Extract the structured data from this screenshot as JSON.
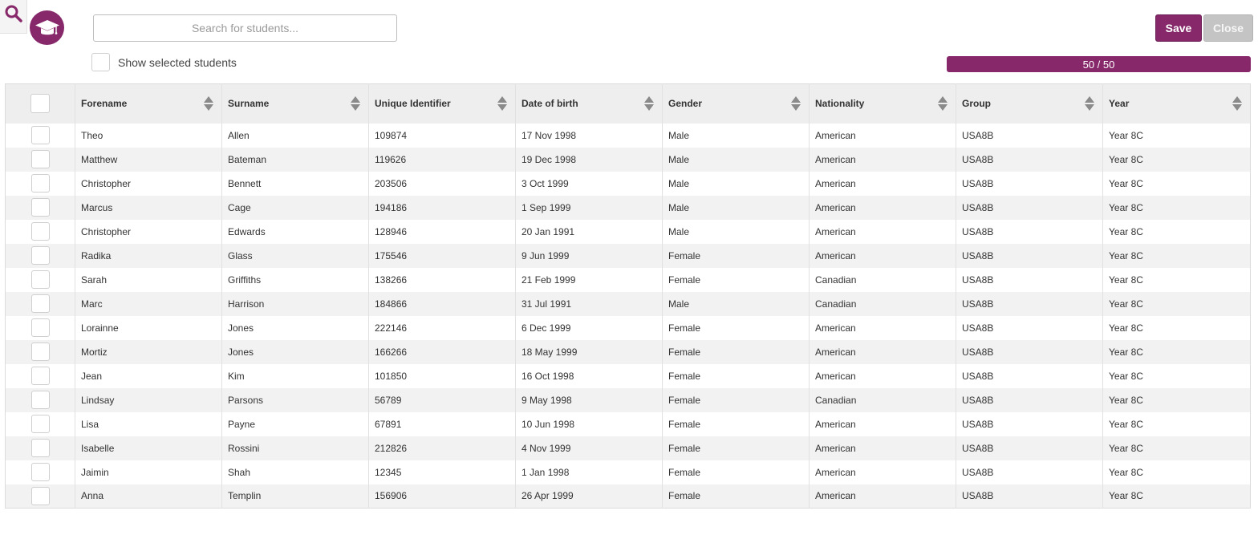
{
  "search": {
    "placeholder": "Search for students...",
    "value": ""
  },
  "show_selected": {
    "label": "Show selected students",
    "checked": false
  },
  "buttons": {
    "save": "Save",
    "close": "Close"
  },
  "progress": {
    "text": "50 / 50",
    "current": 50,
    "total": 50
  },
  "colors": {
    "brand": "#86286a",
    "close_button": "#c4c4c4",
    "header_bg": "#eeeeee",
    "row_alt": "#f2f2f2"
  },
  "icons": {
    "corner": "search-icon",
    "logo": "graduation-cap-icon",
    "sort": "sort-icon"
  },
  "table": {
    "columns": [
      "Forename",
      "Surname",
      "Unique Identifier",
      "Date of birth",
      "Gender",
      "Nationality",
      "Group",
      "Year"
    ],
    "rows": [
      [
        "Theo",
        "Allen",
        "109874",
        "17 Nov 1998",
        "Male",
        "American",
        "USA8B",
        "Year 8C"
      ],
      [
        "Matthew",
        "Bateman",
        "119626",
        "19 Dec 1998",
        "Male",
        "American",
        "USA8B",
        "Year 8C"
      ],
      [
        "Christopher",
        "Bennett",
        "203506",
        "3 Oct 1999",
        "Male",
        "American",
        "USA8B",
        "Year 8C"
      ],
      [
        "Marcus",
        "Cage",
        "194186",
        "1 Sep 1999",
        "Male",
        "American",
        "USA8B",
        "Year 8C"
      ],
      [
        "Christopher",
        "Edwards",
        "128946",
        "20 Jan 1991",
        "Male",
        "American",
        "USA8B",
        "Year 8C"
      ],
      [
        "Radika",
        "Glass",
        "175546",
        "9 Jun 1999",
        "Female",
        "American",
        "USA8B",
        "Year 8C"
      ],
      [
        "Sarah",
        "Griffiths",
        "138266",
        "21 Feb 1999",
        "Female",
        "Canadian",
        "USA8B",
        "Year 8C"
      ],
      [
        "Marc",
        "Harrison",
        "184866",
        "31 Jul 1991",
        "Male",
        "Canadian",
        "USA8B",
        "Year 8C"
      ],
      [
        "Lorainne",
        "Jones",
        "222146",
        "6 Dec 1999",
        "Female",
        "American",
        "USA8B",
        "Year 8C"
      ],
      [
        "Mortiz",
        "Jones",
        "166266",
        "18 May 1999",
        "Female",
        "American",
        "USA8B",
        "Year 8C"
      ],
      [
        "Jean",
        "Kim",
        "101850",
        "16 Oct 1998",
        "Female",
        "American",
        "USA8B",
        "Year 8C"
      ],
      [
        "Lindsay",
        "Parsons",
        "56789",
        "9 May 1998",
        "Female",
        "Canadian",
        "USA8B",
        "Year 8C"
      ],
      [
        "Lisa",
        "Payne",
        "67891",
        "10 Jun 1998",
        "Female",
        "American",
        "USA8B",
        "Year 8C"
      ],
      [
        "Isabelle",
        "Rossini",
        "212826",
        "4 Nov 1999",
        "Female",
        "American",
        "USA8B",
        "Year 8C"
      ],
      [
        "Jaimin",
        "Shah",
        "12345",
        "1 Jan 1998",
        "Female",
        "American",
        "USA8B",
        "Year 8C"
      ],
      [
        "Anna",
        "Templin",
        "156906",
        "26 Apr 1999",
        "Female",
        "American",
        "USA8B",
        "Year 8C"
      ]
    ]
  }
}
